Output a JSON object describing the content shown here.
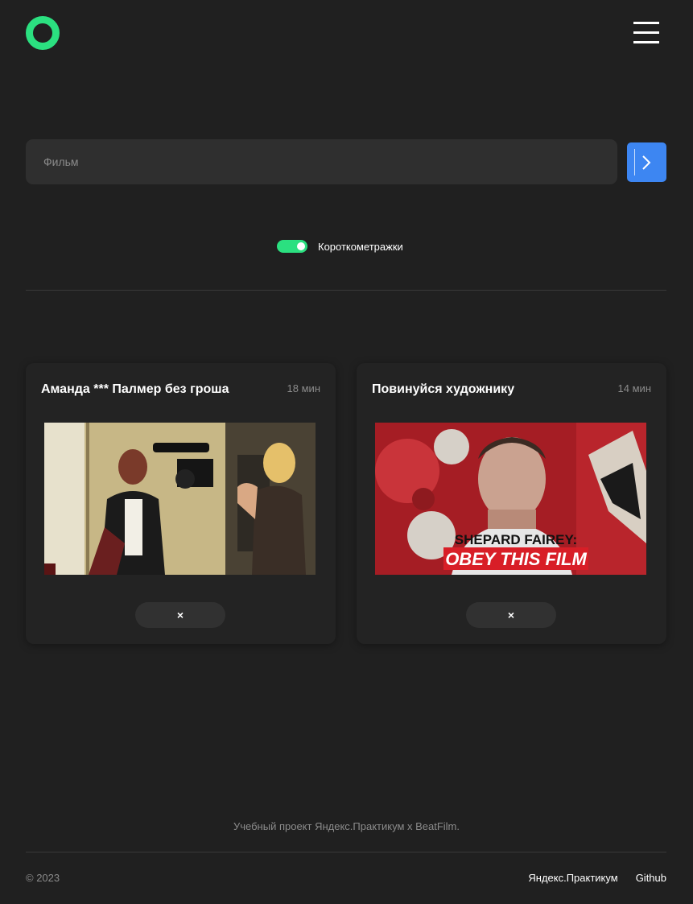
{
  "header": {
    "logo_icon": "ring-logo-icon",
    "menu_icon": "hamburger-menu-icon"
  },
  "search": {
    "placeholder": "Фильм",
    "value": "",
    "submit_icon": "chevron-right-icon"
  },
  "filter": {
    "label": "Короткометражки",
    "checked": true
  },
  "movies": [
    {
      "title": "Аманда *** Палмер без гроша",
      "duration": "18 мин",
      "delete_label": "×"
    },
    {
      "title": "Повинуйся художнику",
      "duration": "14 мин",
      "delete_label": "×",
      "thumb_text_1": "SHEPARD FAIREY:",
      "thumb_text_2": "OBEY THIS FILM"
    }
  ],
  "footer": {
    "caption": "Учебный проект Яндекс.Практикум х BeatFilm.",
    "copyright": "© 2023",
    "links": [
      "Яндекс.Практикум",
      "Github"
    ]
  },
  "colors": {
    "background": "#202020",
    "accent_green": "#2be080",
    "accent_blue": "#3d86f2",
    "input_bg": "#2f2f2f",
    "muted_text": "#8b8b8b"
  }
}
